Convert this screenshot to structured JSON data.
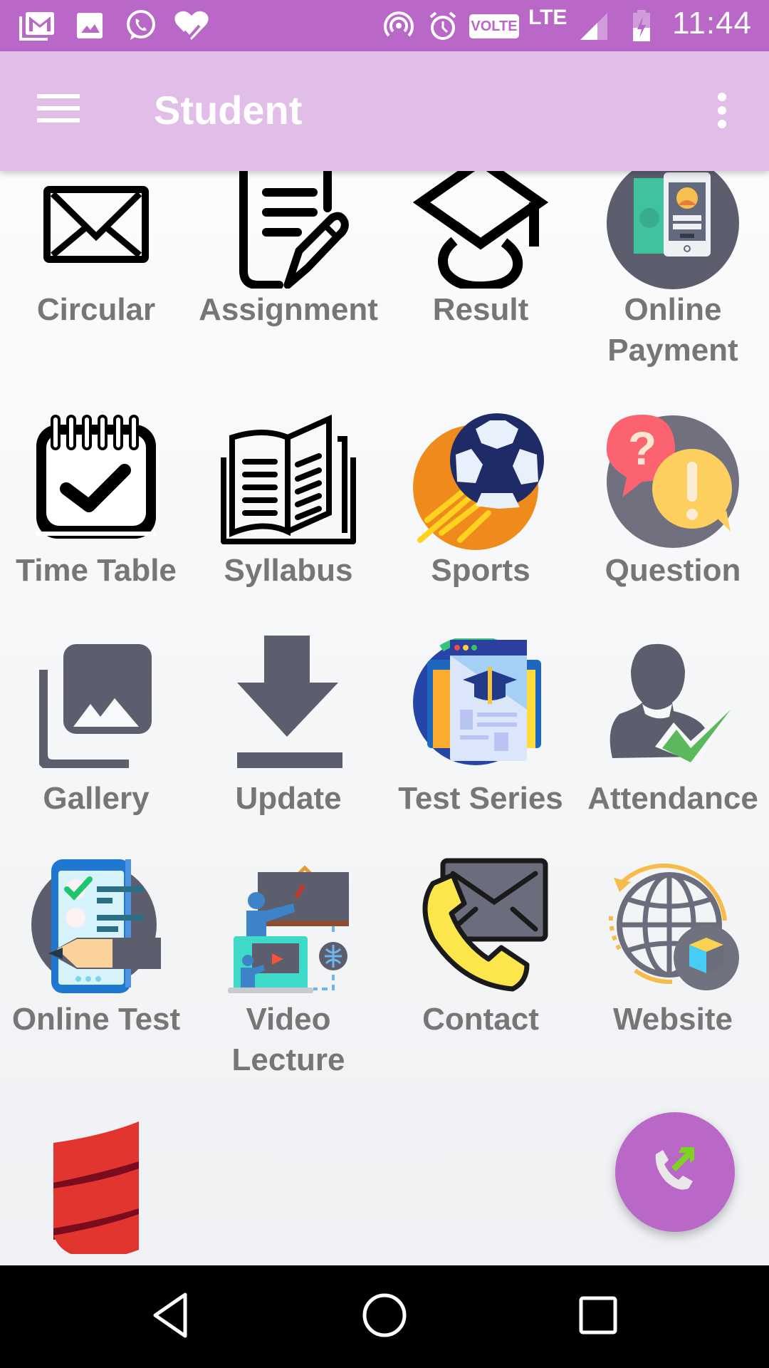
{
  "status_bar": {
    "time": "11:44",
    "network_label": "LTE",
    "volte_label": "VOLTE",
    "left_icons": [
      "gmail-icon",
      "gallery-notification-icon",
      "whatsapp-icon",
      "health-heart-icon"
    ],
    "right_icons": [
      "hotspot-icon",
      "alarm-icon",
      "volte-icon",
      "lte-icon",
      "signal-icon",
      "battery-charging-icon"
    ]
  },
  "toolbar": {
    "title": "Student",
    "menu_icon": "hamburger-menu-icon",
    "overflow_icon": "more-vert-icon"
  },
  "grid": {
    "items": [
      {
        "label": "Circular",
        "icon": "envelope-icon"
      },
      {
        "label": "Assignment",
        "icon": "assignment-edit-icon"
      },
      {
        "label": "Result",
        "icon": "graduation-cap-icon"
      },
      {
        "label": "Online Payment",
        "label_line1": "Online",
        "label_line2": "Payment",
        "icon": "mobile-payment-icon"
      },
      {
        "label": "Time Table",
        "icon": "calendar-check-icon"
      },
      {
        "label": "Syllabus",
        "icon": "open-book-icon"
      },
      {
        "label": "Sports",
        "icon": "soccer-ball-icon"
      },
      {
        "label": "Question",
        "icon": "question-speech-bubbles-icon"
      },
      {
        "label": "Gallery",
        "icon": "photo-library-icon"
      },
      {
        "label": "Update",
        "icon": "download-icon"
      },
      {
        "label": "Test Series",
        "icon": "online-course-icon"
      },
      {
        "label": "Attendance",
        "icon": "user-check-icon"
      },
      {
        "label": "Online Test",
        "icon": "mobile-quiz-icon"
      },
      {
        "label": "Video Lecture",
        "label_line1": "Video",
        "label_line2": "Lecture",
        "icon": "video-lecture-icon"
      },
      {
        "label": "Contact",
        "icon": "phone-mail-icon"
      },
      {
        "label": "Website",
        "icon": "globe-icon"
      },
      {
        "label": "",
        "icon": "scroll-ribbon-icon"
      }
    ]
  },
  "fab": {
    "icon": "call-outgoing-icon"
  },
  "nav_bar": {
    "buttons": [
      "back",
      "home",
      "recents"
    ]
  },
  "colors": {
    "status_bar": "#b968c7",
    "toolbar": "#e1bee7",
    "fab": "#ba68c8",
    "label_text": "#767676",
    "icon_gray": "#5c5e6e"
  }
}
